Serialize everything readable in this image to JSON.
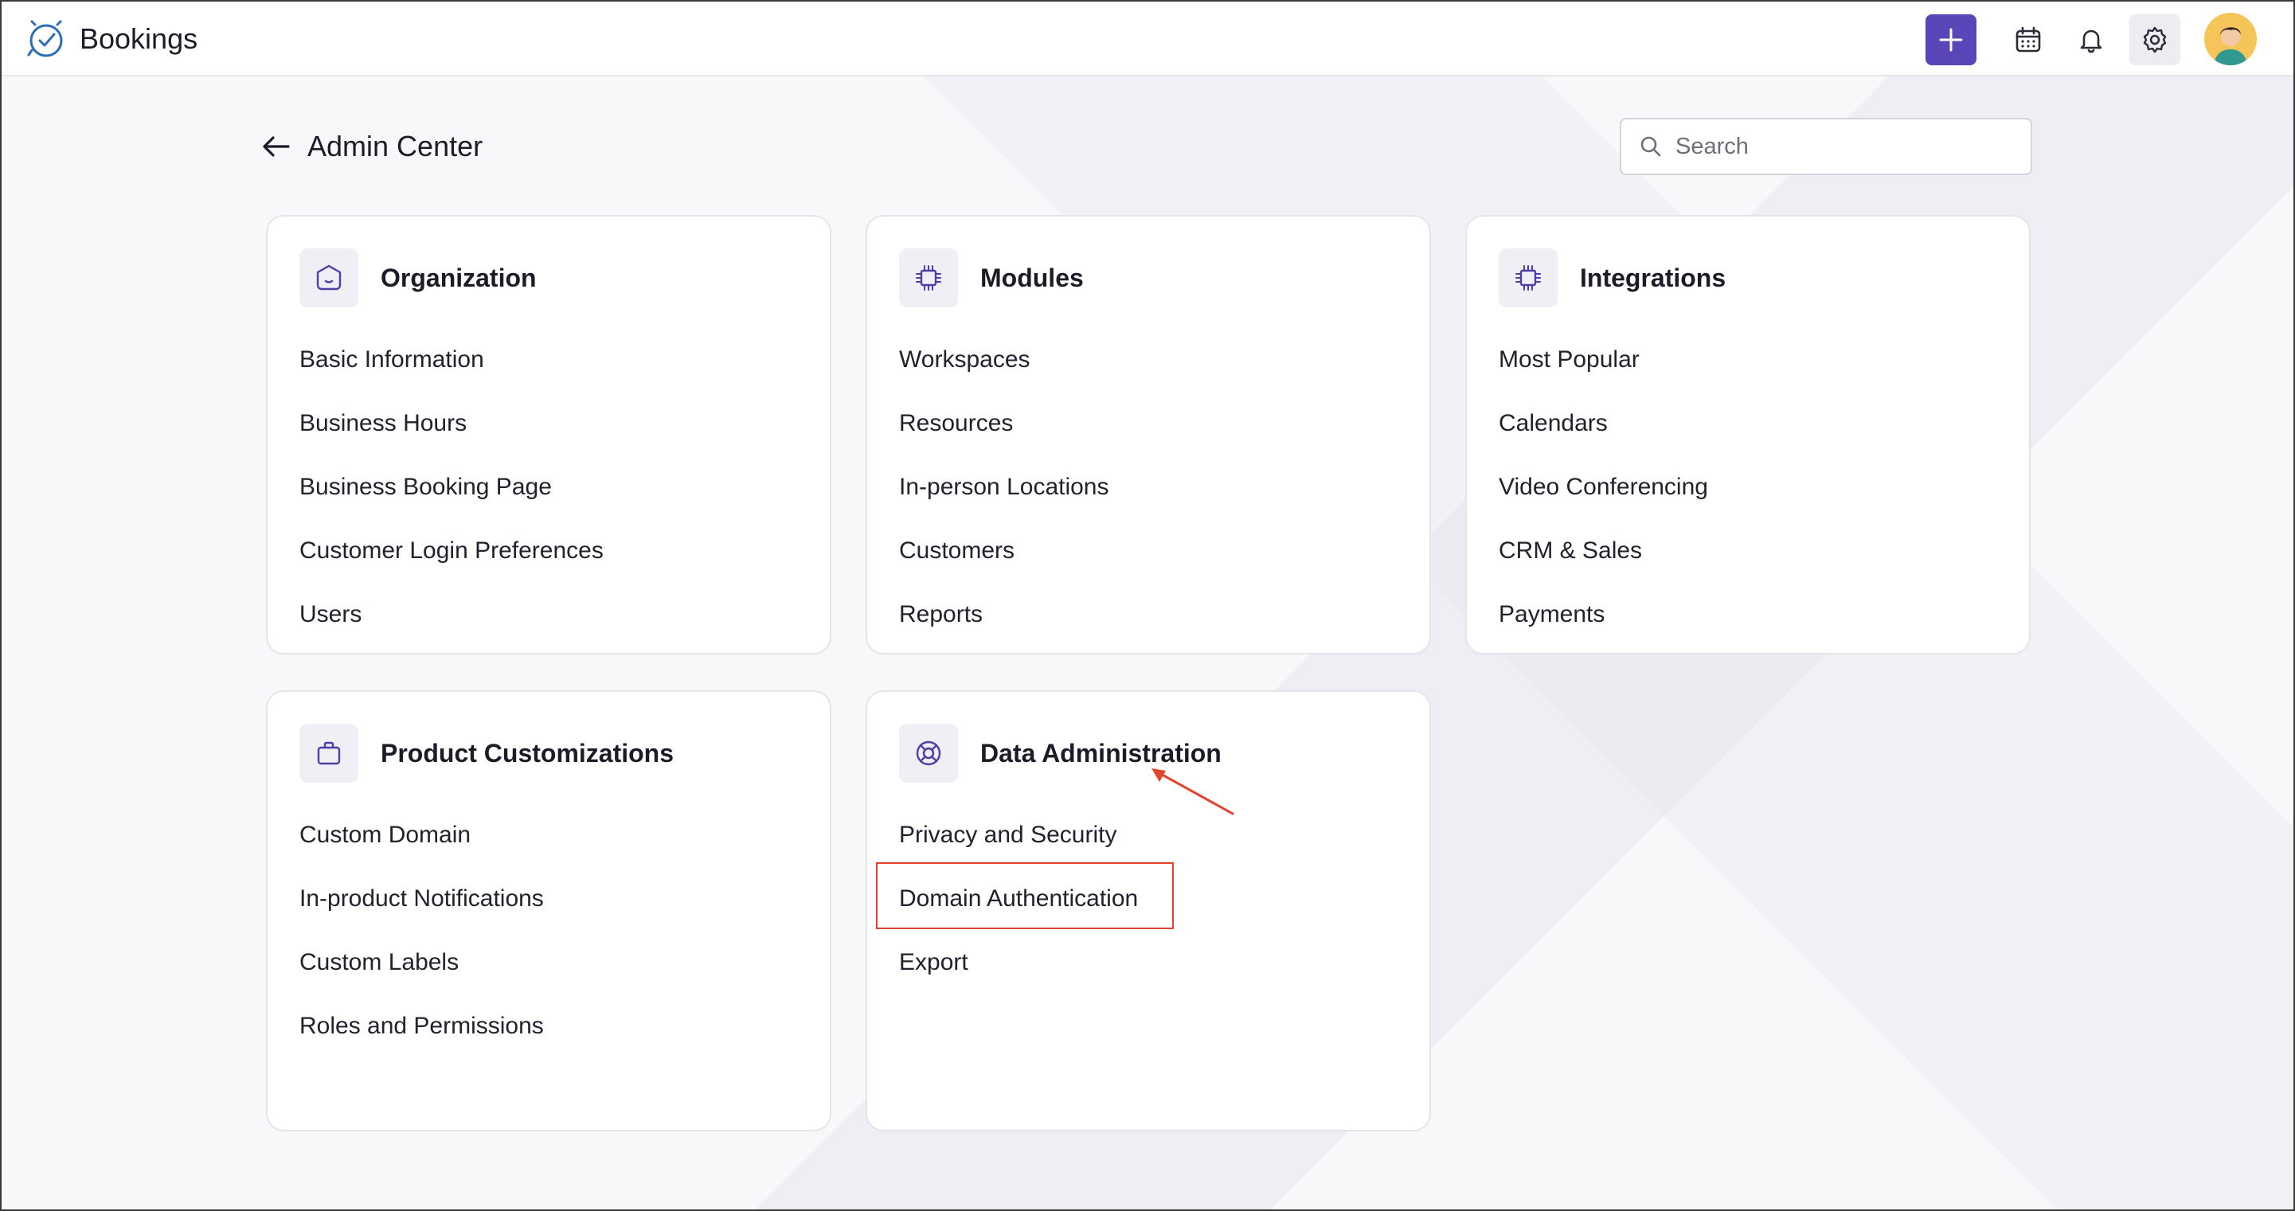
{
  "app": {
    "name": "Bookings"
  },
  "topbar": {
    "add_icon": "plus-icon",
    "calendar_icon": "calendar-icon",
    "bell_icon": "bell-icon",
    "settings_icon": "gear-icon",
    "accent": "#5a46b8"
  },
  "page": {
    "title": "Admin Center",
    "back_icon": "arrow-left-icon"
  },
  "search": {
    "placeholder": "Search",
    "value": ""
  },
  "cards": [
    {
      "title": "Organization",
      "icon": "organization-icon",
      "links": [
        "Basic Information",
        "Business Hours",
        "Business Booking Page",
        "Customer Login Preferences",
        "Users"
      ]
    },
    {
      "title": "Modules",
      "icon": "chip-icon",
      "links": [
        "Workspaces",
        "Resources",
        "In-person Locations",
        "Customers",
        "Reports"
      ]
    },
    {
      "title": "Integrations",
      "icon": "chip-icon",
      "links": [
        "Most Popular",
        "Calendars",
        "Video Conferencing",
        "CRM & Sales",
        "Payments"
      ]
    },
    {
      "title": "Product Customizations",
      "icon": "briefcase-icon",
      "links": [
        "Custom Domain",
        "In-product Notifications",
        "Custom Labels",
        "Roles and Permissions"
      ]
    },
    {
      "title": "Data Administration",
      "icon": "lifebuoy-icon",
      "links": [
        "Privacy and Security",
        "Domain Authentication",
        "Export"
      ]
    }
  ],
  "annotation": {
    "color": "#e0452f"
  }
}
